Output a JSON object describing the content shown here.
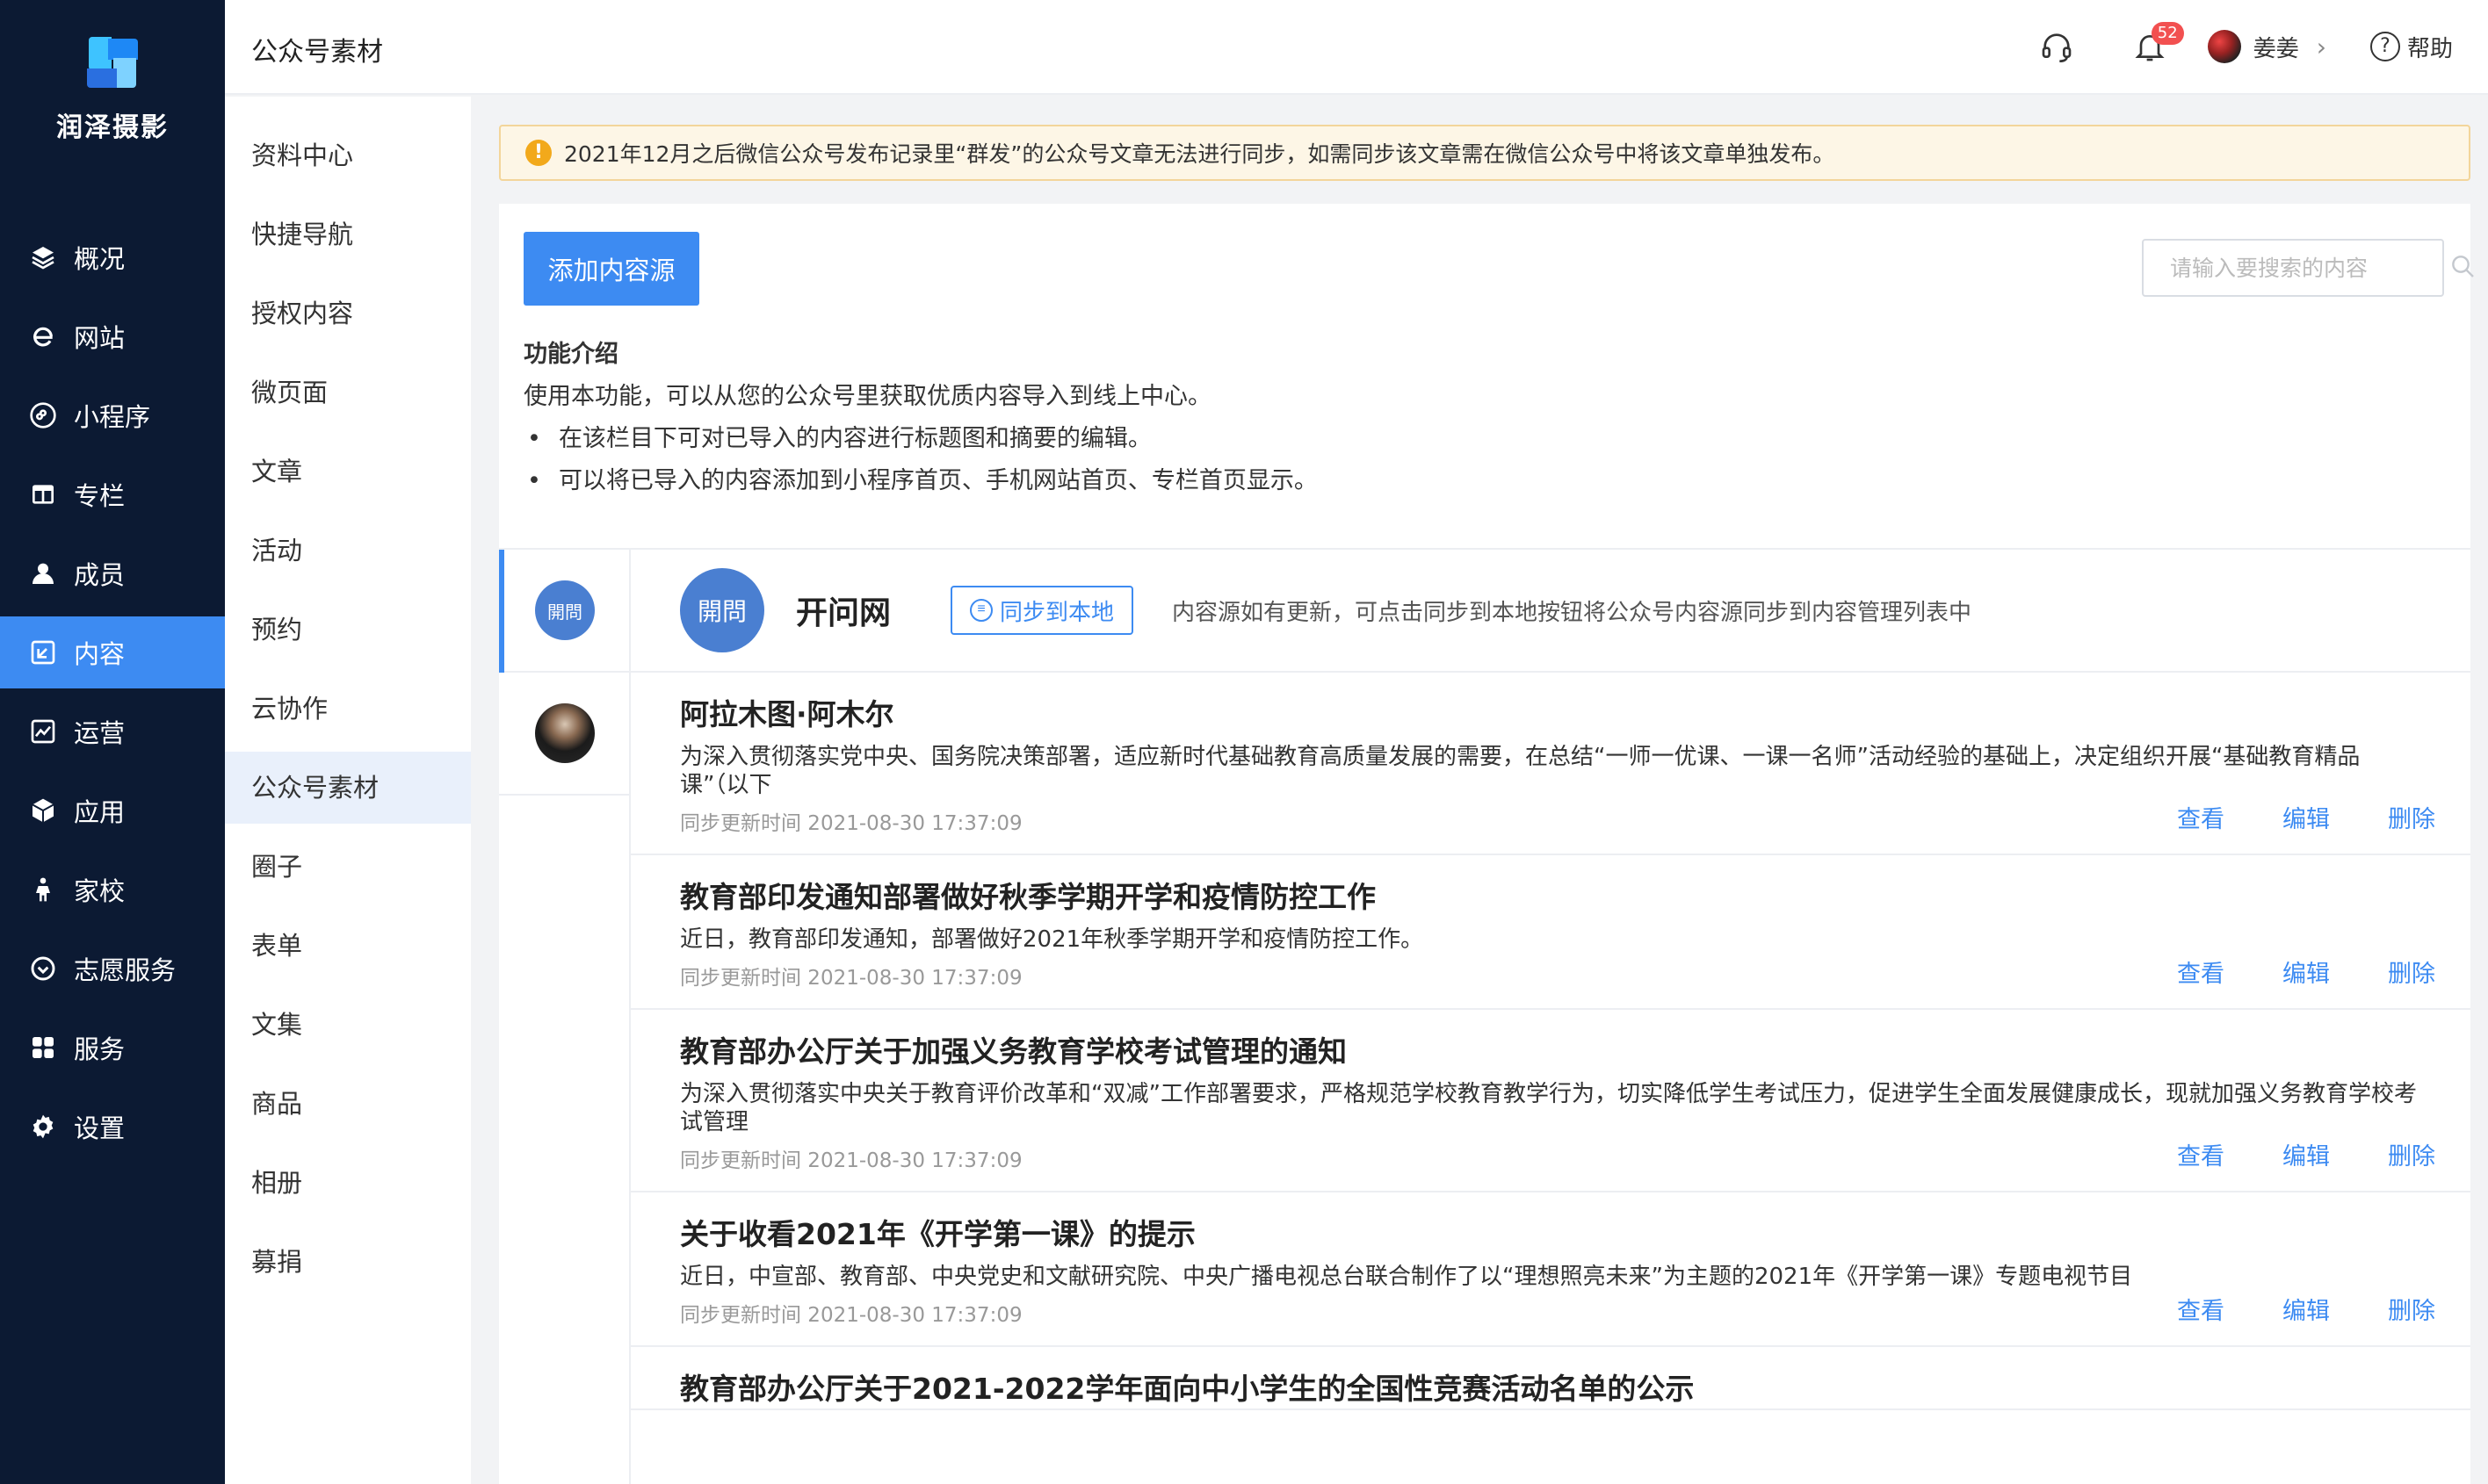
{
  "brand": {
    "name": "润泽摄影"
  },
  "nav": {
    "items": [
      {
        "label": "概况",
        "icon": "layers-icon",
        "active": false
      },
      {
        "label": "网站",
        "icon": "browser-e-icon",
        "active": false
      },
      {
        "label": "小程序",
        "icon": "miniprogram-icon",
        "active": false
      },
      {
        "label": "专栏",
        "icon": "column-table-icon",
        "active": false
      },
      {
        "label": "成员",
        "icon": "user-icon",
        "active": false
      },
      {
        "label": "内容",
        "icon": "content-edit-icon",
        "active": true
      },
      {
        "label": "运营",
        "icon": "chart-line-icon",
        "active": false
      },
      {
        "label": "应用",
        "icon": "box-icon",
        "active": false
      },
      {
        "label": "家校",
        "icon": "family-icon",
        "active": false
      },
      {
        "label": "志愿服务",
        "icon": "volunteer-icon",
        "active": false
      },
      {
        "label": "服务",
        "icon": "grid-apps-icon",
        "active": false
      },
      {
        "label": "设置",
        "icon": "gear-icon",
        "active": false
      }
    ]
  },
  "page": {
    "title": "公众号素材"
  },
  "subnav": {
    "items": [
      {
        "label": "资料中心",
        "active": false
      },
      {
        "label": "快捷导航",
        "active": false
      },
      {
        "label": "授权内容",
        "active": false
      },
      {
        "label": "微页面",
        "active": false
      },
      {
        "label": "文章",
        "active": false
      },
      {
        "label": "活动",
        "active": false
      },
      {
        "label": "预约",
        "active": false
      },
      {
        "label": "云协作",
        "active": false
      },
      {
        "label": "公众号素材",
        "active": true
      },
      {
        "label": "圈子",
        "active": false
      },
      {
        "label": "表单",
        "active": false
      },
      {
        "label": "文集",
        "active": false
      },
      {
        "label": "商品",
        "active": false
      },
      {
        "label": "相册",
        "active": false
      },
      {
        "label": "募捐",
        "active": false
      }
    ]
  },
  "header": {
    "notification_count": "52",
    "user_name": "姜姜",
    "help_label": "帮助"
  },
  "notice": {
    "text": "2021年12月之后微信公众号发布记录里“群发”的公众号文章无法进行同步，如需同步该文章需在微信公众号中将该文章单独发布。"
  },
  "toolbar": {
    "add_label": "添加内容源",
    "search_placeholder": "请输入要搜索的内容"
  },
  "intro": {
    "title": "功能介绍",
    "text": "使用本功能，可以从您的公众号里获取优质内容导入到线上中心。",
    "bullets": [
      "在该栏目下可对已导入的内容进行标题图和摘要的编辑。",
      "可以将已导入的内容添加到小程序首页、手机网站首页、专栏首页显示。"
    ]
  },
  "source": {
    "avatar_text": "開問",
    "name": "开问网",
    "sync_label": "同步到本地",
    "hint": "内容源如有更新，可点击同步到本地按钮将公众号内容源同步到内容管理列表中"
  },
  "articles": [
    {
      "title": "阿拉木图·阿木尔",
      "desc": "为深入贯彻落实党中央、国务院决策部署，适应新时代基础教育高质量发展的需要，在总结“一师一优课、一课一名师”活动经验的基础上，决定组织开展“基础教育精品课”（以下",
      "time": "同步更新时间 2021-08-30 17:37:09"
    },
    {
      "title": "教育部印发通知部署做好秋季学期开学和疫情防控工作",
      "desc": "近日，教育部印发通知，部署做好2021年秋季学期开学和疫情防控工作。",
      "time": "同步更新时间 2021-08-30 17:37:09"
    },
    {
      "title": "教育部办公厅关于加强义务教育学校考试管理的通知",
      "desc": "为深入贯彻落实中央关于教育评价改革和“双减”工作部署要求，严格规范学校教育教学行为，切实降低学生考试压力，促进学生全面发展健康成长，现就加强义务教育学校考试管理",
      "time": "同步更新时间 2021-08-30 17:37:09"
    },
    {
      "title": "关于收看2021年《开学第一课》的提示",
      "desc": "近日，中宣部、教育部、中央党史和文献研究院、中央广播电视总台联合制作了以“理想照亮未来”为主题的2021年《开学第一课》专题电视节目",
      "time": "同步更新时间 2021-08-30 17:37:09"
    },
    {
      "title": "教育部办公厅关于2021-2022学年面向中小学生的全国性竞赛活动名单的公示",
      "desc": "",
      "time": ""
    }
  ],
  "actions": {
    "view": "查看",
    "edit": "编辑",
    "delete": "删除"
  },
  "colors": {
    "sidebar": "#0c1a33",
    "accent": "#3d8bf2",
    "notice_bg": "#fdf6e6"
  }
}
